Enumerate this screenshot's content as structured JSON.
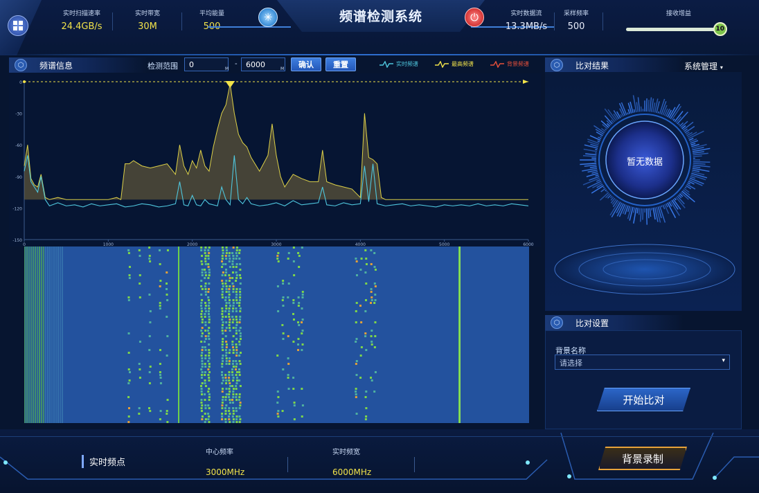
{
  "header": {
    "title": "频谱检测系统",
    "stats_left": [
      {
        "label": "实时扫描速率",
        "value": "24.4GB/s"
      },
      {
        "label": "实时带宽",
        "value": "30M"
      },
      {
        "label": "平均能量",
        "value": "500"
      }
    ],
    "stats_right": [
      {
        "label": "实时数据流",
        "value": "13.3MB/s"
      },
      {
        "label": "采样频率",
        "value": "500"
      }
    ],
    "gain": {
      "label": "接收增益",
      "value": "10",
      "fraction": 0.97
    }
  },
  "spectrum_panel": {
    "title": "频谱信息",
    "range_label": "检测范围",
    "range_min": "0",
    "range_max": "6000",
    "unit": "M",
    "dash": "-",
    "confirm_label": "确认",
    "reset_label": "重置",
    "legend": [
      {
        "label": "实时频谱",
        "color": "#4fc7de"
      },
      {
        "label": "最高频谱",
        "color": "#f2e34a"
      },
      {
        "label": "背景频谱",
        "color": "#e8503a"
      }
    ]
  },
  "chart_data": {
    "type": "line",
    "xlim": [
      0,
      6000
    ],
    "ylim": [
      -150,
      0
    ],
    "x_ticks": [
      "0",
      "1000",
      "2000",
      "3000",
      "4000",
      "5000",
      "6000"
    ],
    "y_ticks": [
      "0",
      "-30",
      "-60",
      "-90",
      "-120",
      "-150"
    ],
    "marker_x": 2450,
    "series": [
      {
        "name": "实时频谱",
        "color": "#4fc7de",
        "x": [
          0,
          40,
          80,
          120,
          160,
          200,
          250,
          300,
          400,
          500,
          600,
          700,
          800,
          900,
          1000,
          1100,
          1200,
          1300,
          1400,
          1500,
          1600,
          1700,
          1800,
          1850,
          1900,
          1950,
          2000,
          2050,
          2100,
          2150,
          2200,
          2300,
          2350,
          2400,
          2450,
          2500,
          2550,
          2600,
          2650,
          2700,
          2800,
          2900,
          3000,
          3100,
          3200,
          3300,
          3400,
          3500,
          3550,
          3600,
          3700,
          3800,
          3900,
          4000,
          4050,
          4100,
          4150,
          4200,
          4300,
          4400,
          4500,
          4600,
          4700,
          4800,
          4900,
          5000,
          5100,
          5200,
          5300,
          5400,
          5500,
          5600,
          5700,
          5800,
          5900,
          6000
        ],
        "y": [
          -85,
          -70,
          -95,
          -100,
          -105,
          -90,
          -112,
          -118,
          -115,
          -118,
          -117,
          -119,
          -116,
          -118,
          -117,
          -116,
          -119,
          -118,
          -116,
          -117,
          -119,
          -118,
          -116,
          -95,
          -117,
          -118,
          -108,
          -117,
          -118,
          -112,
          -116,
          -118,
          -100,
          -112,
          -117,
          -70,
          -112,
          -116,
          -110,
          -116,
          -118,
          -117,
          -115,
          -118,
          -113,
          -117,
          -116,
          -115,
          -100,
          -117,
          -118,
          -115,
          -117,
          -116,
          -80,
          -114,
          -78,
          -116,
          -118,
          -117,
          -116,
          -118,
          -117,
          -118,
          -119,
          -117,
          -118,
          -117,
          -118,
          -116,
          -118,
          -117,
          -118,
          -116,
          -117,
          -118
        ]
      },
      {
        "name": "最高频谱",
        "color": "#f2e34a",
        "x": [
          0,
          40,
          80,
          120,
          160,
          200,
          250,
          300,
          400,
          500,
          600,
          700,
          800,
          900,
          1000,
          1100,
          1150,
          1200,
          1250,
          1300,
          1400,
          1500,
          1600,
          1700,
          1800,
          1850,
          1900,
          1950,
          2000,
          2050,
          2100,
          2150,
          2200,
          2250,
          2300,
          2350,
          2400,
          2450,
          2500,
          2550,
          2600,
          2650,
          2700,
          2800,
          2900,
          2950,
          3000,
          3050,
          3100,
          3200,
          3300,
          3400,
          3500,
          3550,
          3600,
          3700,
          3800,
          3900,
          4000,
          4050,
          4100,
          4150,
          4200,
          4250,
          4300,
          4400,
          4500,
          4600,
          4700,
          4800,
          4900,
          5000,
          5100,
          5200,
          5300,
          5400,
          5500,
          5600,
          5700,
          5800,
          5900,
          6000
        ],
        "y": [
          -80,
          -60,
          -92,
          -98,
          -100,
          -88,
          -110,
          -112,
          -110,
          -112,
          -112,
          -112,
          -112,
          -112,
          -112,
          -110,
          -112,
          -78,
          -78,
          -75,
          -80,
          -82,
          -80,
          -78,
          -88,
          -60,
          -80,
          -88,
          -75,
          -82,
          -65,
          -80,
          -85,
          -62,
          -45,
          -30,
          -22,
          -2,
          -30,
          -50,
          -58,
          -62,
          -72,
          -85,
          -70,
          -40,
          -70,
          -90,
          -100,
          -88,
          -92,
          -95,
          -95,
          -65,
          -95,
          -98,
          -100,
          -102,
          -110,
          -30,
          -72,
          -74,
          -78,
          -110,
          -112,
          -112,
          -112,
          -112,
          -112,
          -112,
          -112,
          -112,
          -112,
          -112,
          -112,
          -112,
          -112,
          -112,
          -112,
          -112,
          -112,
          -112
        ]
      }
    ]
  },
  "waterfall": {
    "type": "heatmap"
  },
  "compare_panel": {
    "title": "比对结果",
    "system_menu": "系统管理",
    "empty_text": "暂无数据"
  },
  "settings_panel": {
    "title": "比对设置",
    "bg_name_label": "背景名称",
    "select_placeholder": "请选择",
    "start_label": "开始比对"
  },
  "footer": {
    "realtime_label": "实时频点",
    "center_freq_label": "中心频率",
    "center_freq_value": "3000MHz",
    "bandwidth_label": "实时频宽",
    "bandwidth_value": "6000MHz",
    "record_label": "背景录制"
  },
  "colors": {
    "accent": "#3f7fe0",
    "highlight": "#f2e34a",
    "alert": "#e8503a",
    "background": "#071530"
  }
}
